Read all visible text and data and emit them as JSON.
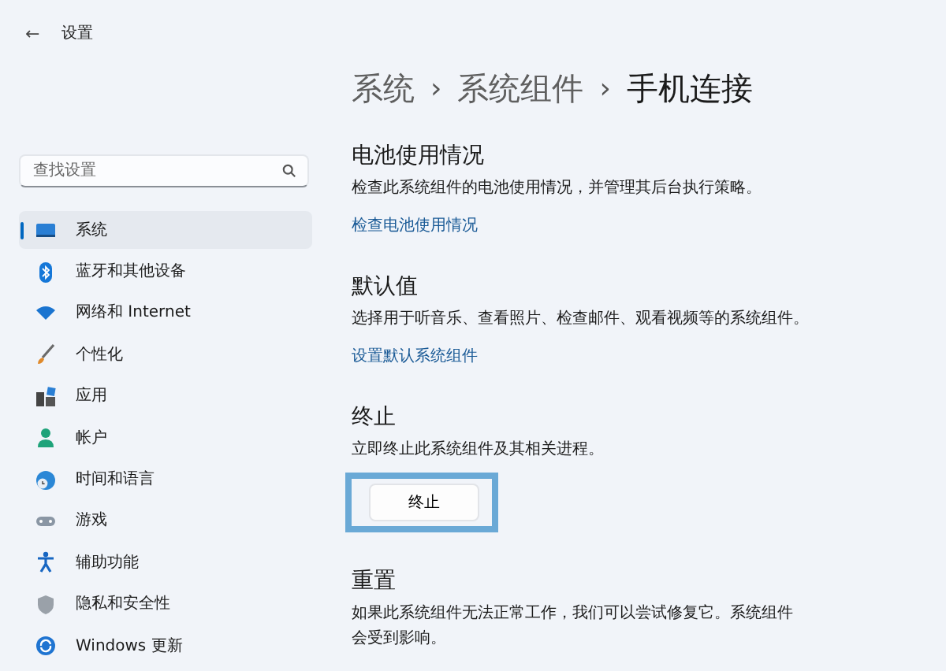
{
  "window": {
    "back": "←",
    "title": "设置"
  },
  "search": {
    "placeholder": "查找设置"
  },
  "sidebar": {
    "items": [
      {
        "label": "系统",
        "selected": true
      },
      {
        "label": "蓝牙和其他设备",
        "selected": false
      },
      {
        "label": "网络和 Internet",
        "selected": false
      },
      {
        "label": "个性化",
        "selected": false
      },
      {
        "label": "应用",
        "selected": false
      },
      {
        "label": "帐户",
        "selected": false
      },
      {
        "label": "时间和语言",
        "selected": false
      },
      {
        "label": "游戏",
        "selected": false
      },
      {
        "label": "辅助功能",
        "selected": false
      },
      {
        "label": "隐私和安全性",
        "selected": false
      },
      {
        "label": "Windows 更新",
        "selected": false
      }
    ]
  },
  "breadcrumb": [
    {
      "kind": "item",
      "text": "系统"
    },
    {
      "kind": "separator",
      "text": "›"
    },
    {
      "kind": "item",
      "text": "系统组件"
    },
    {
      "kind": "separator",
      "text": "›"
    },
    {
      "kind": "item",
      "text": "手机连接"
    }
  ],
  "sections": [
    {
      "title": "电池使用情况",
      "description": "检查此系统组件的电池使用情况，并管理其后台执行策略。",
      "action": {
        "kind": "link",
        "text": "检查电池使用情况"
      }
    },
    {
      "title": "默认值",
      "description": "选择用于听音乐、查看照片、检查邮件、观看视频等的系统组件。",
      "action": {
        "kind": "link",
        "text": "设置默认系统组件"
      }
    },
    {
      "title": "终止",
      "description": "立即终止此系统组件及其相关进程。",
      "action": {
        "kind": "button",
        "text": "终止",
        "highlighted": true
      }
    },
    {
      "title": "重置",
      "description": "如果此系统组件无法正常工作，我们可以尝试修复它。系统组件会受到影响。"
    }
  ]
}
